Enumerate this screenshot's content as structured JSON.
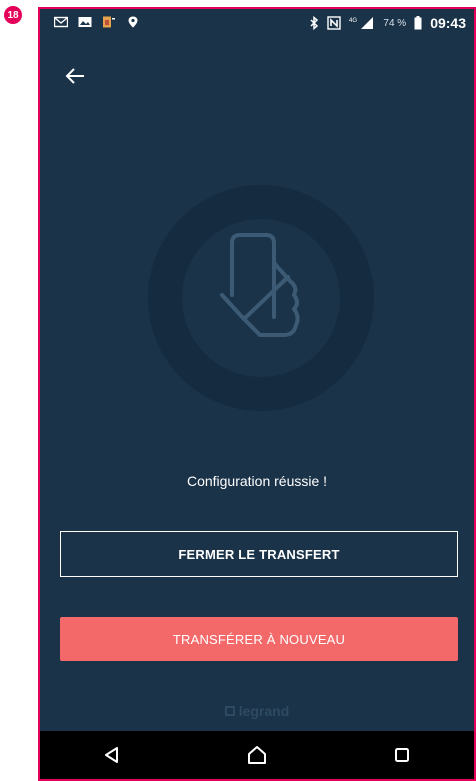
{
  "step_badge": "18",
  "status_bar": {
    "left_icons": [
      "mail-icon",
      "image-icon",
      "sim-icon",
      "location-icon"
    ],
    "right_icons": [
      "bluetooth-icon",
      "nfc-icon",
      "signal-icon"
    ],
    "battery": "74 %",
    "time": "09:43"
  },
  "header": {
    "back_icon": "arrow-left-icon"
  },
  "hero": {
    "icon": "phone-in-hand-check-icon"
  },
  "message": "Configuration réussie !",
  "actions": {
    "close_label": "FERMER LE TRANSFERT",
    "retry_label": "TRANSFÉRER À NOUVEAU"
  },
  "brand": "legrand",
  "colors": {
    "background": "#1a3349",
    "accent": "#f3696a",
    "frame": "#e5005a"
  },
  "nav": [
    "back-triangle-icon",
    "home-icon",
    "recents-icon"
  ]
}
